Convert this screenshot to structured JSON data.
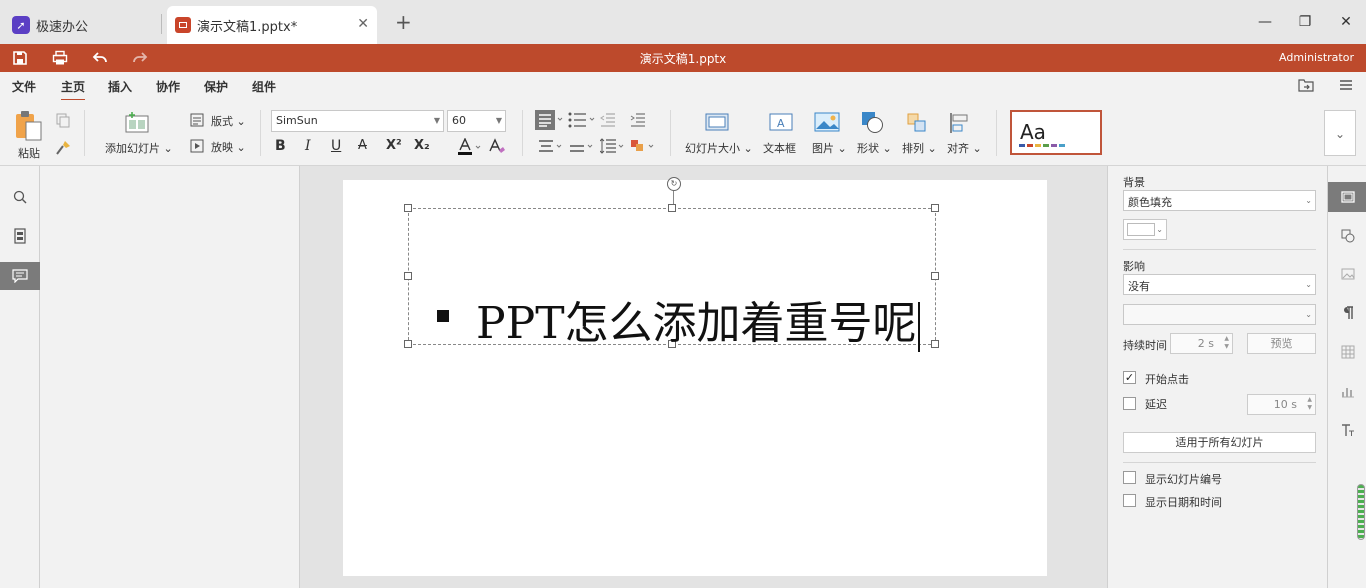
{
  "tabs": {
    "app_name": "极速办公",
    "document_name": "演示文稿1.pptx*",
    "close_glyph": "✕",
    "new_tab_glyph": "+"
  },
  "window": {
    "minimize": "—",
    "restore": "❐",
    "close": "✕"
  },
  "quickbar": {
    "title": "演示文稿1.pptx",
    "user": "Administrator",
    "icons": [
      "save-icon",
      "print-icon",
      "undo-icon",
      "redo-icon"
    ]
  },
  "menu": {
    "items": [
      "文件",
      "主页",
      "插入",
      "协作",
      "保护",
      "组件"
    ],
    "active": "主页"
  },
  "ribbon": {
    "paste": "粘贴",
    "add_slide": "添加幻灯片",
    "layout": "版式",
    "play": "放映",
    "font_name": "SimSun",
    "font_size": "60",
    "bold": "B",
    "italic": "I",
    "underline": "U",
    "strike": "A",
    "superscript": "X²",
    "subscript": "X₂",
    "slide_size": "幻灯片大小",
    "textbox": "文本框",
    "picture": "图片",
    "shape": "形状",
    "arrange": "排列",
    "align": "对齐",
    "theme_preview": "Aa",
    "theme_colors": [
      "#3a5aa8",
      "#c9452a",
      "#e9b440",
      "#5a9e4a",
      "#8a5aa8",
      "#4aa0c9"
    ]
  },
  "slide": {
    "text": "PPT怎么添加着重号呢"
  },
  "right_panel": {
    "background_label": "背景",
    "background_fill": "颜色填充",
    "effect_label": "影响",
    "effect_value": "没有",
    "effect_option": "",
    "duration_label": "持续时间",
    "duration_value": "2 s",
    "preview_button": "预览",
    "start_on_click": "开始点击",
    "start_on_click_checked": true,
    "delay_label": "延迟",
    "delay_checked": false,
    "delay_value": "10 s",
    "apply_all_button": "适用于所有幻灯片",
    "show_slide_number": "显示幻灯片编号",
    "show_date_time": "显示日期和时间"
  }
}
